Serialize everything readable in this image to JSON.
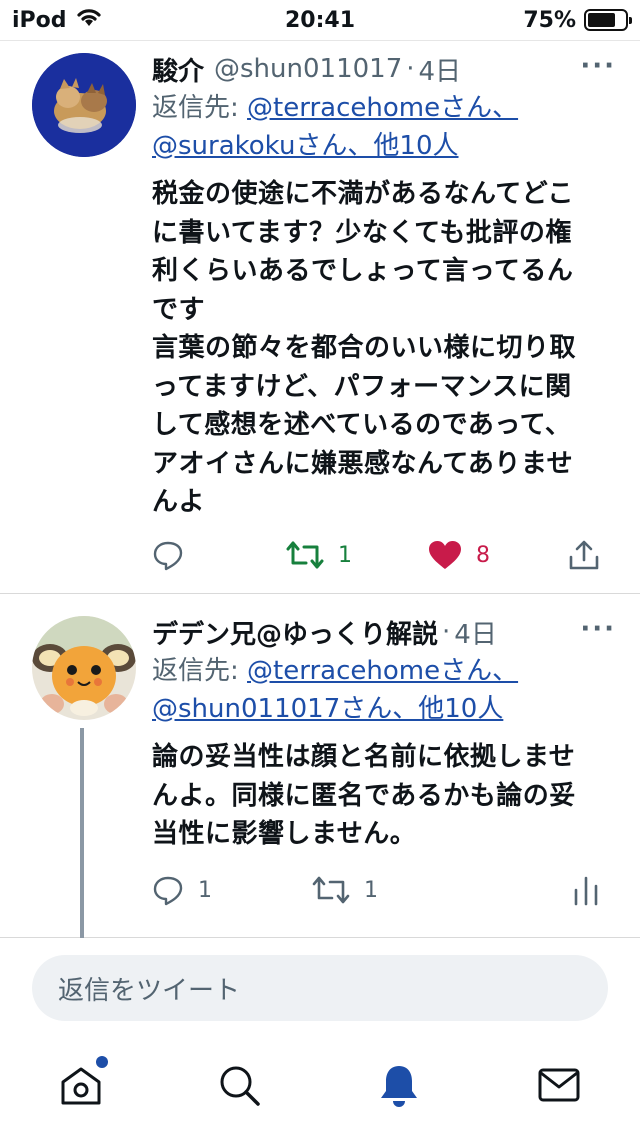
{
  "status_bar": {
    "carrier": "iPod",
    "time": "20:41",
    "battery": "75%",
    "battery_level": 0.75
  },
  "tweets": [
    {
      "name": "駿介",
      "handle": "@shun011017",
      "dot": "·",
      "date": "4日",
      "more": "···",
      "reply_prefix": "返信先: ",
      "reply_mentions_line1": "@terracehomeさん、",
      "reply_mentions_line2": "@surakokuさん、他10人",
      "body": "税金の使途に不満があるなんてどこ\nに書いてます？少なくても批評の権\n利くらいあるでしょって言ってるん\nです\n言葉の節々を都合のいい様に切り取\nってますけど、パフォーマンスに関\nして感想を述べているのであって、\nアオイさんに嫌悪感なんてありませ\nんよ",
      "retweet_count": "1",
      "like_count": "8",
      "avatar_icon": "cat-photo-avatar"
    },
    {
      "name": "デデン兄@ゆっくり解説",
      "dot": "·",
      "date": "4日",
      "more": "···",
      "reply_prefix": "返信先: ",
      "reply_mentions_line1": "@terracehomeさん、",
      "reply_mentions_line2": "@shun011017さん、他10人",
      "body": "論の妥当性は顔と名前に依拠しませ\nんよ。同様に匿名であるかも論の妥\n当性に影響しません。",
      "reply_count": "1",
      "retweet_count": "1",
      "avatar_icon": "dedenne-avatar"
    }
  ],
  "reply_bar": {
    "placeholder": "返信をツイート"
  },
  "tabbar": {
    "items": [
      "home-icon",
      "search-icon",
      "notifications-icon",
      "messages-icon"
    ],
    "active": "notifications-icon"
  },
  "colors": {
    "link": "#1d4ea8",
    "retweet_active": "#17803d",
    "like_active": "#c81b4a",
    "muted": "#536471"
  }
}
